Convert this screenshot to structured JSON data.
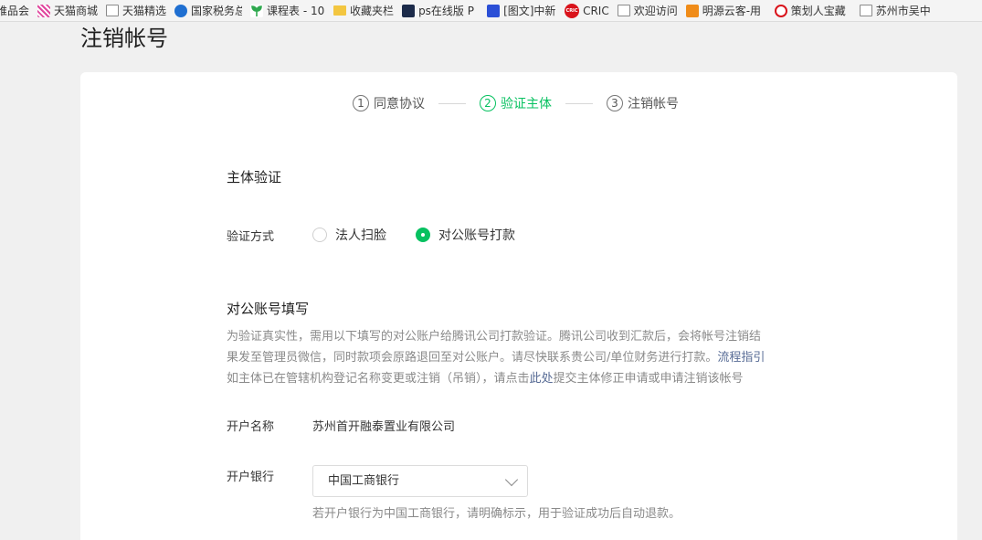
{
  "bookmarks": [
    {
      "label": "唯品会",
      "icon": "none"
    },
    {
      "label": "天猫商城",
      "icon": "tmall-icon"
    },
    {
      "label": "天猫精选",
      "icon": "page-icon"
    },
    {
      "label": "国家税务总",
      "icon": "tax-icon"
    },
    {
      "label": "课程表 - 10",
      "icon": "sprout-icon"
    },
    {
      "label": "收藏夹栏",
      "icon": "folder-icon"
    },
    {
      "label": "ps在线版 P",
      "icon": "ps-icon"
    },
    {
      "label": "[图文]中新",
      "icon": "paw-icon"
    },
    {
      "label": "CRIC",
      "icon": "cric-icon"
    },
    {
      "label": "欢迎访问",
      "icon": "page-icon"
    },
    {
      "label": "明源云客-用",
      "icon": "cloud-icon"
    },
    {
      "label": "策划人宝藏",
      "icon": "percent-icon"
    },
    {
      "label": "苏州市吴中",
      "icon": "page-icon"
    }
  ],
  "cric_icon_text": "CRIC",
  "page": {
    "title": "注销帐号"
  },
  "steps": [
    {
      "num": "1",
      "label": "同意协议"
    },
    {
      "num": "2",
      "label": "验证主体"
    },
    {
      "num": "3",
      "label": "注销帐号"
    }
  ],
  "subject": {
    "title": "主体验证"
  },
  "verify": {
    "label": "验证方式",
    "options": [
      "法人扫脸",
      "对公账号打款"
    ],
    "selected": "对公账号打款"
  },
  "account": {
    "title": "对公账号填写",
    "desc_line1": "为验证真实性，需用以下填写的对公账户给腾讯公司打款验证。腾讯公司收到汇款后，会将帐号注销结",
    "desc_line2": "果发至管理员微信，同时款项会原路退回至对公账户。请尽快联系贵公司/单位财务进行打款。",
    "desc_link1": "流程指引",
    "desc_line3a": "如主体已在管辖机构登记名称变更或注销（吊销），请点击",
    "desc_link2": "此处",
    "desc_line3b": "提交主体修正申请或申请注销该帐号",
    "name_label": "开户名称",
    "name_value": "苏州首开融泰置业有限公司",
    "bank_label": "开户银行",
    "bank_value": "中国工商银行",
    "bank_hint": "若开户银行为中国工商银行，请明确标示，用于验证成功后自动退款。"
  },
  "colors": {
    "accent": "#07c160",
    "link": "#576b95"
  }
}
